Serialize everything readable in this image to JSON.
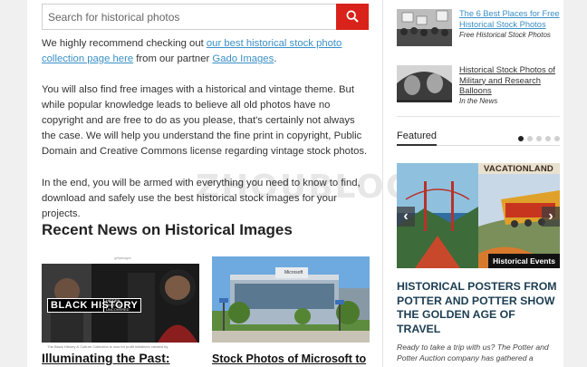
{
  "search": {
    "placeholder": "Search for historical photos"
  },
  "intro": {
    "p1_before": "We highly recommend checking out ",
    "p1_link": "our best historical stock photo collection page here",
    "p1_middle": " from our partner ",
    "p1_link2": "Gado Images",
    "p1_after": ".",
    "p2": "You will also find free images with a historical and vintage theme. But while popular knowledge leads to believe all old photos have no copyright and are free to do as you please, that's certainly not always the case. We will help you understand the fine print in copyright, Public Domain and Creative Commons license regarding vintage stock photos.",
    "p3": "In the end, you will be armed with everything you need to know to find, download and safely use the best historical stock images for your projects."
  },
  "recent_news": {
    "heading": "Recent News on Historical Images",
    "cards": [
      {
        "title": "Illuminating the Past:",
        "image_logo": "gettyimages",
        "image_text": "BLACK HISTORY",
        "image_subtext": "HIDDEN UNTOLD UNCOVERED",
        "caption": "The Black History & Culture Collection is now for profit initiatives created by"
      },
      {
        "title": "Stock Photos of Microsoft to",
        "image_sign": "Microsoft"
      }
    ]
  },
  "sidebar": {
    "related": [
      {
        "title": "The 6 Best Places for Free Historical Stock Photos",
        "category": "Free Historical Stock Photos"
      },
      {
        "title": "Historical Stock Photos of Military and Research Balloons",
        "category": "In the News"
      }
    ],
    "featured_tab": "Featured",
    "slides_count": 5,
    "active_slide": 0,
    "slide": {
      "poster_text": "VACATIONLAND",
      "category": "Historical Events",
      "prev_icon": "chevron-left-icon",
      "next_icon": "chevron-right-icon"
    },
    "featured_title": "HISTORICAL POSTERS FROM POTTER AND POTTER SHOW THE GOLDEN AGE OF TRAVEL",
    "featured_excerpt": "Ready to take a trip with us? The Potter and Potter Auction company has gathered a"
  },
  "colors": {
    "accent_red": "#d9221a",
    "link_blue": "#3a8fc7",
    "featured_title": "#1c3d52"
  },
  "watermark": {
    "text": "ZHOUBLOG.C"
  }
}
